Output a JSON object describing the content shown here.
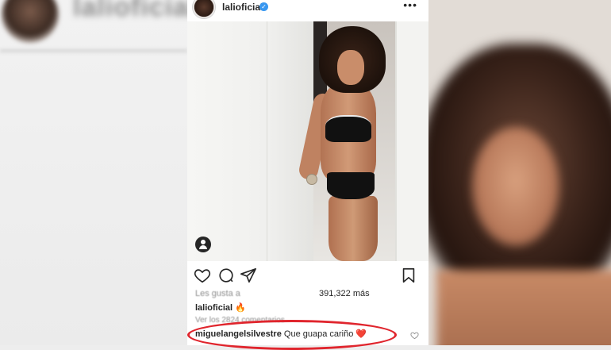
{
  "background": {
    "left_blurred_username": "lalioficial"
  },
  "post": {
    "username": "lalioficial",
    "verified_icon": "verified-badge-icon",
    "more_icon": "more-options-icon",
    "user_tag_icon": "user-tag-icon",
    "actions": {
      "like_icon": "heart-outline-icon",
      "comment_icon": "comment-bubble-icon",
      "share_icon": "paper-plane-icon",
      "save_icon": "bookmark-icon"
    },
    "likes_prefix": "Les gusta a",
    "likes_count": "391,322 más",
    "caption_user": "lalioficial",
    "caption_text": "🔥",
    "view_comments": "Ver los 2824 comentarios",
    "comment": {
      "user": "miguelangelsilvestre",
      "text": "Que guapa cariño",
      "emoji": "❤️"
    }
  },
  "colors": {
    "highlight_oval": "#e0252d",
    "verified": "#3897f0"
  }
}
